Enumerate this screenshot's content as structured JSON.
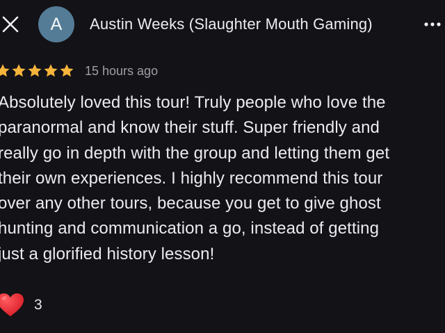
{
  "header": {
    "avatar_letter": "A",
    "author_name": "Austin Weeks (Slaughter Mouth Gaming)",
    "close_icon": "close-icon",
    "more_icon": "more-horizontal-icon"
  },
  "review": {
    "rating": 5,
    "max_rating": 5,
    "time_ago": "15 hours ago",
    "text": "Absolutely loved this tour! Truly people who love the\nparanormal and know their stuff. Super friendly and\nreally go in depth with the group and letting them get\ntheir own experiences. I highly recommend this tour\nover any other tours, because you get to give ghost\nhunting and communication a go, instead of getting\njust a glorified history lesson!"
  },
  "reactions": {
    "icon": "heart-icon",
    "count": "3"
  },
  "colors": {
    "background": "#131217",
    "star": "#f6b53b",
    "heart": "#e5262e",
    "avatar": "#547c96",
    "muted_text": "#9e9ea6"
  }
}
